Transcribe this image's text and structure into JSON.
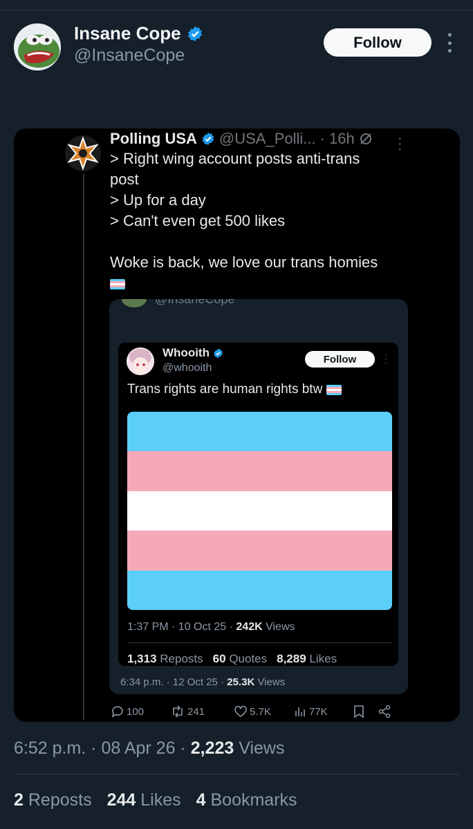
{
  "header": {
    "name": "Insane Cope",
    "handle": "@InsaneCope",
    "follow_label": "Follow",
    "verified": true
  },
  "quoted_post": {
    "name": "Polling USA",
    "handle": "@USA_Polli...",
    "time": "· 16h",
    "lines": [
      "> Right wing account posts anti-trans",
      "post",
      "> Up for a day",
      "> Can't even get 500 likes",
      "",
      "Woke is back, we love our trans homies"
    ],
    "inner_cut_handle": "@InsaneCope",
    "inner_meta": {
      "time": "6:34 p.m. · 12 Oct 25 ·",
      "views_count": "25.3K",
      "views_label": "Views"
    },
    "embedded": {
      "name": "Whooith",
      "handle": "@whooith",
      "follow_label": "Follow",
      "text": "Trans rights are human rights btw",
      "meta_time": "1:37 PM · 10 Oct 25 ·",
      "views_count": "242K",
      "views_label": "Views",
      "reposts_count": "1,313",
      "reposts_label": "Reposts",
      "quotes_count": "60",
      "quotes_label": "Quotes",
      "likes_count": "8,289",
      "likes_label": "Likes",
      "flag_colors": [
        "#5bcefa",
        "#f5a9b8",
        "#ffffff",
        "#f5a9b8",
        "#5bcefa"
      ]
    },
    "actions": {
      "replies": "100",
      "reposts": "241",
      "likes": "5.7K",
      "views": "77K"
    }
  },
  "footer": {
    "timestamp": "6:52 p.m. · 08 Apr 26 ·",
    "views_count": "2,223",
    "views_label": "Views",
    "reposts_count": "2",
    "reposts_label": "Reposts",
    "likes_count": "244",
    "likes_label": "Likes",
    "bookmarks_count": "4",
    "bookmarks_label": "Bookmarks"
  },
  "colors": {
    "background": "#15202b",
    "verified": "#1d9bf0",
    "text_secondary": "#8b98a5"
  }
}
